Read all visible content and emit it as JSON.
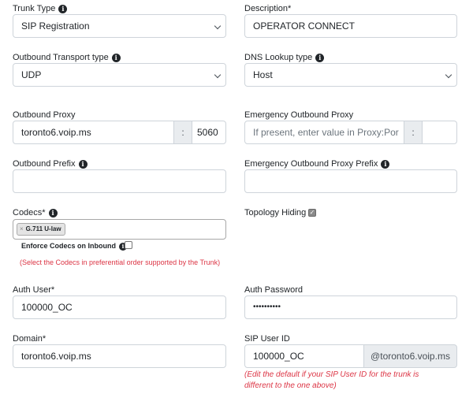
{
  "form": {
    "trunk_type": {
      "label": "Trunk Type",
      "value": "SIP Registration"
    },
    "description": {
      "label": "Description*",
      "value": "OPERATOR CONNECT"
    },
    "outbound_transport": {
      "label": "Outbound Transport type",
      "value": "UDP"
    },
    "dns_lookup": {
      "label": "DNS Lookup type",
      "value": "Host"
    },
    "outbound_proxy": {
      "label": "Outbound Proxy",
      "host": "toronto6.voip.ms",
      "separator": ":",
      "port": "5060"
    },
    "emergency_proxy": {
      "label": "Emergency Outbound Proxy",
      "placeholder": "If present, enter value in Proxy:Por",
      "separator": ":",
      "port": ""
    },
    "outbound_prefix": {
      "label": "Outbound Prefix",
      "value": ""
    },
    "emergency_prefix": {
      "label": "Emergency Outbound Proxy Prefix",
      "value": ""
    },
    "codecs": {
      "label": "Codecs*",
      "selected": [
        "G.711 U-law"
      ],
      "remove_symbol": "×",
      "enforce_label": "Enforce Codecs on Inbound",
      "enforce_checked": false,
      "hint": "(Select the Codecs in preferential order supported by the Trunk)"
    },
    "topology_hiding": {
      "label": "Topology Hiding",
      "checked": true,
      "check_symbol": "✓"
    },
    "auth_user": {
      "label": "Auth User*",
      "value": "100000_OC"
    },
    "auth_password": {
      "label": "Auth Password",
      "value": "••••••••••"
    },
    "domain": {
      "label": "Domain*",
      "value": "toronto6.voip.ms"
    },
    "sip_user_id": {
      "label": "SIP User ID",
      "value": "100000_OC",
      "suffix": "@toronto6.voip.ms",
      "hint_line1": "(Edit the default if your SIP User ID for the trunk is",
      "hint_line2": "different to the one above)"
    }
  },
  "icons": {
    "info": "info-circle-icon",
    "chevron": "chevron-down-icon",
    "remove": "remove-x-icon",
    "check": "checkmark-icon"
  }
}
